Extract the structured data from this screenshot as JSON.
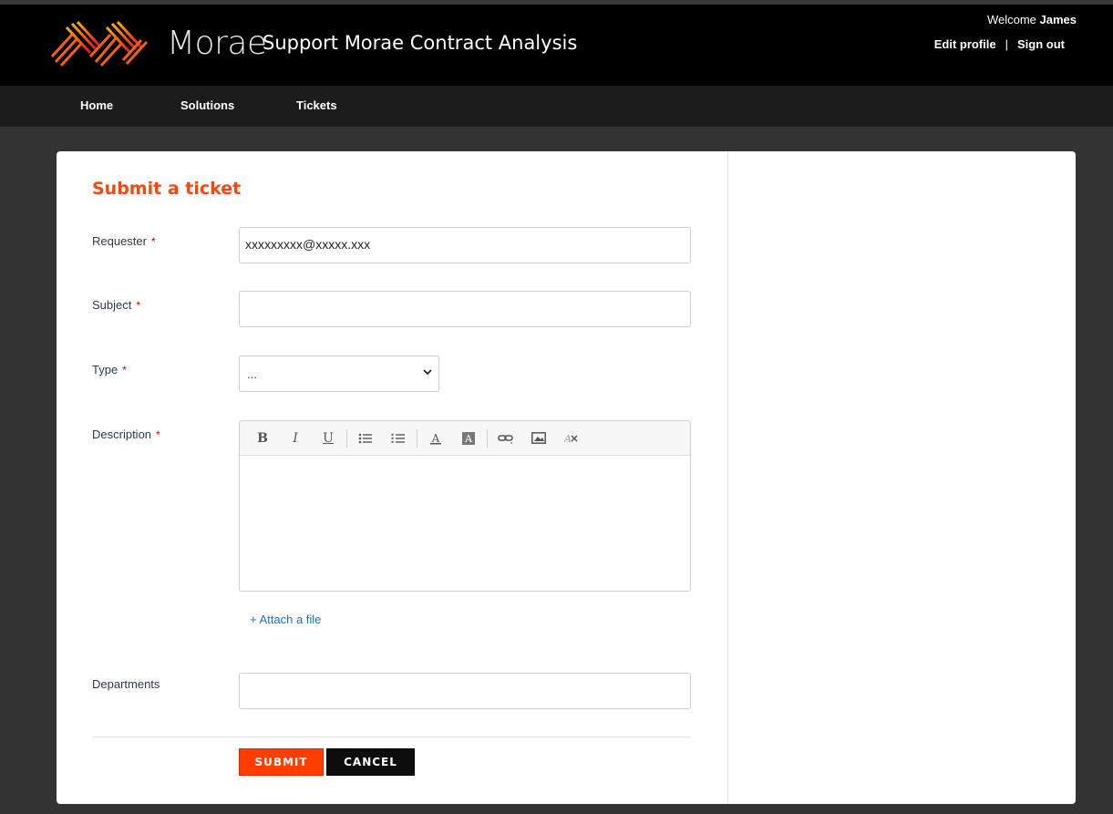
{
  "header": {
    "brand": "Morae",
    "subtitle": "Support Morae Contract Analysis",
    "welcome_prefix": "Welcome",
    "user_name": "James",
    "edit_profile": "Edit profile",
    "separator": "|",
    "sign_out": "Sign out"
  },
  "nav": {
    "home": "Home",
    "solutions": "Solutions",
    "tickets": "Tickets"
  },
  "form": {
    "title": "Submit a ticket",
    "requester": {
      "label": "Requester",
      "value": "xxxxxxxxx@xxxxx.xxx"
    },
    "subject": {
      "label": "Subject",
      "value": ""
    },
    "type": {
      "label": "Type",
      "value": "..."
    },
    "description": {
      "label": "Description"
    },
    "required_mark": "*",
    "attach": "+ Attach a file",
    "departments": {
      "label": "Departments",
      "value": ""
    },
    "submit": "SUBMIT",
    "cancel": "CANCEL"
  },
  "colors": {
    "accent": "#ff3d00",
    "title": "#f04a12",
    "link": "#1a6fd6"
  }
}
